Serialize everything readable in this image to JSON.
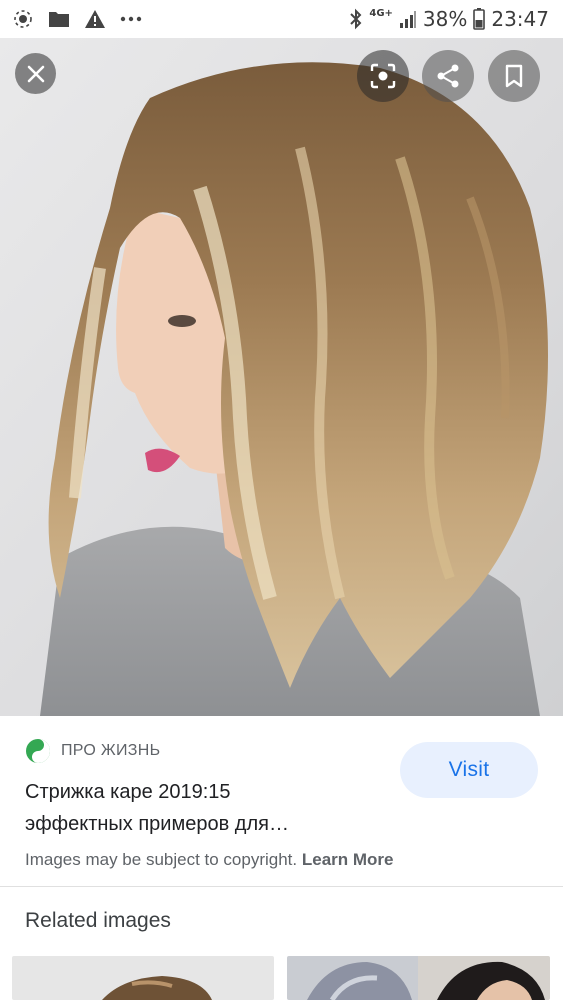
{
  "status_bar": {
    "battery_percent": "38%",
    "time": "23:47",
    "network": "4G+",
    "icons": [
      "wifi-dot-icon",
      "folder-icon",
      "warning-icon",
      "more-icon",
      "bluetooth-icon",
      "signal-icon",
      "battery-icon"
    ]
  },
  "image_viewer": {
    "close_label": "Close",
    "lens_label": "Search image",
    "share_label": "Share",
    "save_label": "Save"
  },
  "result": {
    "source_name": "ПРО ЖИЗНЬ",
    "title_line1": "Стрижка каре 2019:15",
    "title_line2": "эффектных примеров для…",
    "visit_label": "Visit",
    "copyright_text": "Images may be subject to copyright.",
    "learn_more_label": "Learn More"
  },
  "related": {
    "heading": "Related images"
  },
  "colors": {
    "accent": "#1a73e8",
    "visit_bg": "#e8f0fe",
    "source_icon": "#34a853"
  }
}
